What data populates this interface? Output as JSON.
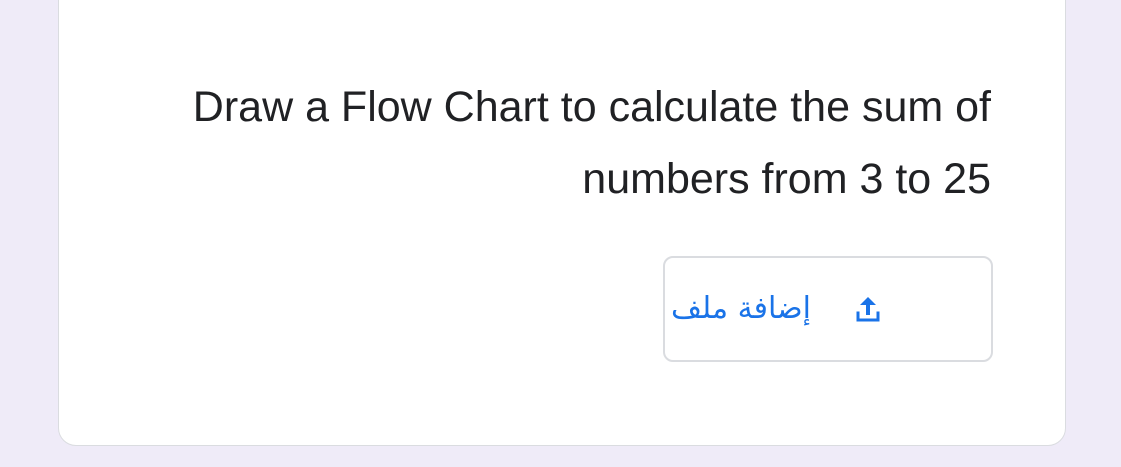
{
  "colors": {
    "page_background": "#efebf8",
    "card_background": "#ffffff",
    "text_primary": "#202124",
    "accent_blue": "#1a73e8",
    "border": "#dadce0"
  },
  "question": {
    "text": "Draw a Flow Chart to calculate the sum of numbers from 3 to 25"
  },
  "upload": {
    "label": "إضافة ملف",
    "icon": "upload-icon"
  }
}
